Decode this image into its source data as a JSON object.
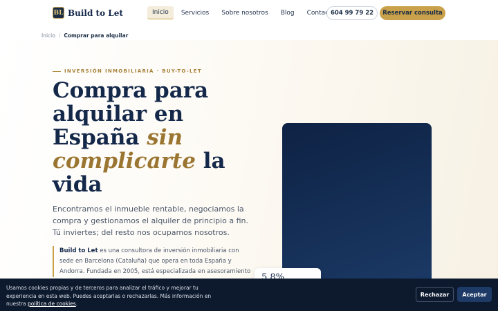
{
  "header": {
    "logo_mark": "BL",
    "logo_text": "Build to Let",
    "nav": [
      {
        "label": "Inicio",
        "active": true
      },
      {
        "label": "Servicios"
      },
      {
        "label": "Sobre nosotros"
      },
      {
        "label": "Blog"
      },
      {
        "label": "Contacto"
      }
    ],
    "phone": "604 99 79 22",
    "cta": "Reservar consulta"
  },
  "breadcrumb": {
    "home": "Inicio",
    "separator": "/",
    "current": "Comprar para alquilar"
  },
  "hero": {
    "eyebrow": "INVERSIÓN INMOBILIARIA · BUY-TO-LET",
    "title_part1": "Compra para alquilar en España ",
    "title_accent": "sin complicarte",
    "title_part2": " la vida",
    "lead": "Encontramos el inmueble rentable, negociamos la compra y gestionamos el alquiler de principio a fin. Tú inviertes; del resto nos ocupamos nosotros.",
    "about_brand": "Build to Let",
    "about_text": " es una consultora de inversión inmobiliaria con sede en Barcelona (Cataluña) que opera en toda España y Andorra. Fundada en 2005, está especializada en asesoramiento",
    "stat_value": "5,8%"
  },
  "cookie": {
    "text": "Usamos cookies propias y de terceros para analizar el tráfico y mejorar tu experiencia en esta web. Puedes aceptarlas o rechazarlas. Más información en nuestra ",
    "link": "política de cookies",
    "end": ".",
    "reject": "Rechazar",
    "accept": "Aceptar"
  },
  "colors": {
    "navy": "#14284a",
    "gold": "#c9a14a",
    "cookie_bg": "#0d1a2e"
  }
}
